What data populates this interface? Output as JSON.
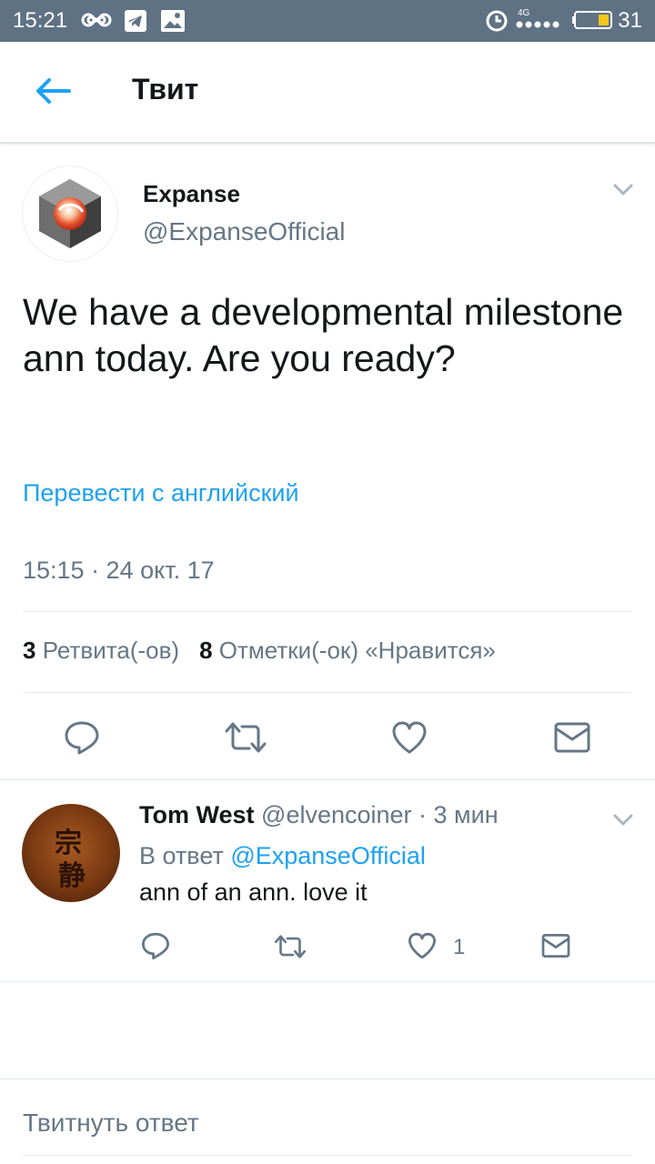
{
  "status_bar": {
    "time": "15:21",
    "network": "4G",
    "battery_level": "31"
  },
  "header": {
    "title": "Твит"
  },
  "tweet": {
    "author_name": "Expanse",
    "author_handle": "@ExpanseOfficial",
    "text": "We have a developmental milestone ann today. Are you ready?",
    "translate_label": "Перевести с английский",
    "timestamp": "15:15 · 24 окт. 17",
    "retweet_count": "3",
    "retweet_label": "Ретвита(-ов)",
    "like_count": "8",
    "like_label": "Отметки(-ок) «Нравится»"
  },
  "reply": {
    "author_name": "Tom West",
    "author_handle": "@elvencoiner",
    "time_ago": "· 3 мин",
    "reply_to_prefix": "В ответ",
    "reply_to_handle": "@ExpanseOfficial",
    "text": "ann of an ann. love it",
    "like_count": "1",
    "avatar_glyphs": [
      "宗",
      "静"
    ]
  },
  "compose": {
    "placeholder": "Твитнуть ответ"
  },
  "colors": {
    "accent": "#1da1f2",
    "secondary_text": "#657786",
    "status_bar": "#5f7284"
  },
  "icons": [
    "back-arrow-icon",
    "chevron-down-icon",
    "reply-icon",
    "retweet-icon",
    "like-icon",
    "direct-message-icon",
    "infinity-icon",
    "telegram-icon",
    "gallery-icon",
    "alarm-icon",
    "signal-icon",
    "battery-icon"
  ]
}
